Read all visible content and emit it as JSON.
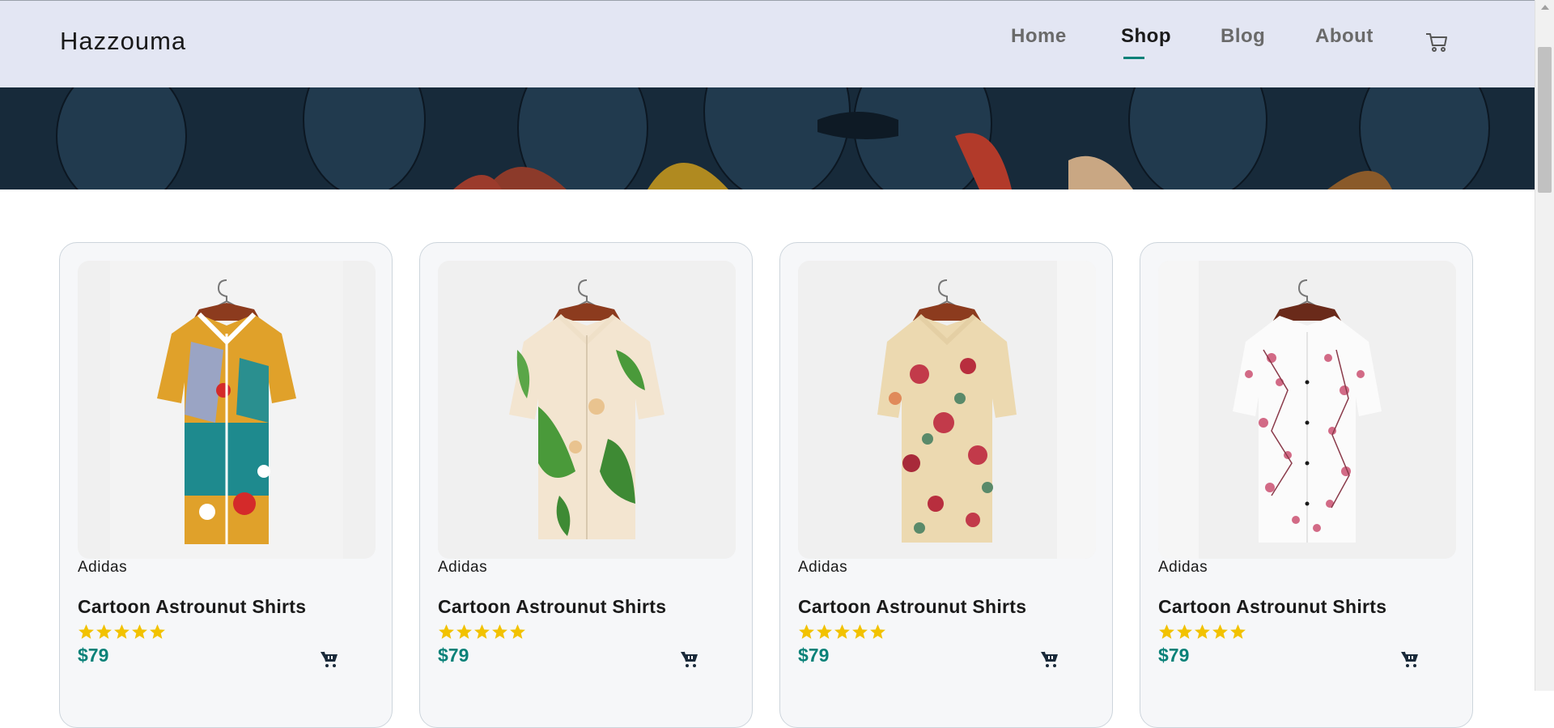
{
  "brand_name": "Hazzouma",
  "nav": {
    "items": [
      {
        "label": "Home",
        "active": false
      },
      {
        "label": "Shop",
        "active": true
      },
      {
        "label": "Blog",
        "active": false
      },
      {
        "label": "About",
        "active": false
      }
    ],
    "cart_icon": "cart-outline-icon"
  },
  "colors": {
    "accent": "#088178",
    "header_bg": "#e3e6f3",
    "star": "#f2c200",
    "hero_bg": "#172a3a"
  },
  "products": [
    {
      "brand": "Adidas",
      "title": "Cartoon Astrounut Shirts",
      "price": "$79",
      "rating": 5,
      "cart_icon": "cart-icon"
    },
    {
      "brand": "Adidas",
      "title": "Cartoon Astrounut Shirts",
      "price": "$79",
      "rating": 5,
      "cart_icon": "cart-icon"
    },
    {
      "brand": "Adidas",
      "title": "Cartoon Astrounut Shirts",
      "price": "$79",
      "rating": 5,
      "cart_icon": "cart-icon"
    },
    {
      "brand": "Adidas",
      "title": "Cartoon Astrounut Shirts",
      "price": "$79",
      "rating": 5,
      "cart_icon": "cart-icon"
    }
  ]
}
